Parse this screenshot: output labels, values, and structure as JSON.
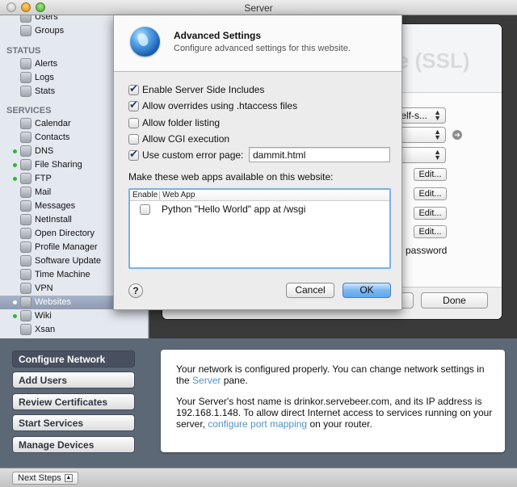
{
  "window": {
    "title": "Server"
  },
  "sidebar": {
    "sections": [
      {
        "label": "STATUS"
      },
      {
        "label": "SERVICES"
      }
    ],
    "top_items": [
      {
        "label": "Users",
        "icon": "users-icon"
      },
      {
        "label": "Groups",
        "icon": "groups-icon"
      }
    ],
    "status_items": [
      {
        "label": "Alerts",
        "icon": "megaphone-icon"
      },
      {
        "label": "Logs",
        "icon": "logs-icon"
      },
      {
        "label": "Stats",
        "icon": "stats-icon"
      }
    ],
    "service_items": [
      {
        "label": "Calendar",
        "icon": "calendar-icon",
        "running": false
      },
      {
        "label": "Contacts",
        "icon": "contacts-icon",
        "running": false
      },
      {
        "label": "DNS",
        "icon": "dns-icon",
        "running": true
      },
      {
        "label": "File Sharing",
        "icon": "file-sharing-icon",
        "running": true
      },
      {
        "label": "FTP",
        "icon": "ftp-icon",
        "running": true
      },
      {
        "label": "Mail",
        "icon": "mail-icon",
        "running": false
      },
      {
        "label": "Messages",
        "icon": "messages-icon",
        "running": false
      },
      {
        "label": "NetInstall",
        "icon": "netinstall-icon",
        "running": false
      },
      {
        "label": "Open Directory",
        "icon": "open-directory-icon",
        "running": false
      },
      {
        "label": "Profile Manager",
        "icon": "profile-manager-icon",
        "running": false
      },
      {
        "label": "Software Update",
        "icon": "software-update-icon",
        "running": false
      },
      {
        "label": "Time Machine",
        "icon": "time-machine-icon",
        "running": false
      },
      {
        "label": "VPN",
        "icon": "vpn-icon",
        "running": false
      },
      {
        "label": "Websites",
        "icon": "websites-icon",
        "running": true,
        "selected": true
      },
      {
        "label": "Wiki",
        "icon": "wiki-icon",
        "running": true
      },
      {
        "label": "Xsan",
        "icon": "xsan-icon",
        "running": false
      }
    ]
  },
  "background_panel": {
    "title": "Server Website (SSL)",
    "ssl_popup": "elf-s...",
    "edit_label": "Edit...",
    "password_text": "password",
    "done_label": "Done"
  },
  "dialog": {
    "title": "Advanced Settings",
    "subtitle": "Configure advanced settings for this website.",
    "options": [
      {
        "label": "Enable Server Side Includes",
        "checked": true
      },
      {
        "label": "Allow overrides using .htaccess files",
        "checked": true
      },
      {
        "label": "Allow folder listing",
        "checked": false
      },
      {
        "label": "Allow CGI execution",
        "checked": false
      },
      {
        "label": "Use custom error page:",
        "checked": true
      }
    ],
    "error_page_value": "dammit.html",
    "webapps_label": "Make these web apps available on this website:",
    "table": {
      "columns": [
        "Enable",
        "Web App"
      ],
      "rows": [
        {
          "enabled": false,
          "app": "Python \"Hello World\" app at /wsgi"
        }
      ]
    },
    "help_label": "?",
    "cancel_label": "Cancel",
    "ok_label": "OK"
  },
  "next_steps": {
    "buttons": [
      {
        "label": "Configure Network",
        "active": true
      },
      {
        "label": "Add Users",
        "active": false
      },
      {
        "label": "Review Certificates",
        "active": false
      },
      {
        "label": "Start Services",
        "active": false
      },
      {
        "label": "Manage Devices",
        "active": false
      }
    ],
    "info": {
      "p1_before": "Your network is configured properly. You can change network settings in the ",
      "p1_link": "Server",
      "p1_after": " pane.",
      "p2_before": "Your Server's host name is drinkor.servebeer.com, and its IP address is 192.168.1.148. To allow direct Internet access to services running on your server, ",
      "p2_link": "configure port mapping",
      "p2_after": " on your router."
    },
    "toggle_label": "Next Steps"
  },
  "colors": {
    "accent_link": "#4e93c9",
    "running_dot": "#2fb733",
    "ok_button": "#7ab7f1",
    "bottom_background": "#5d6877"
  }
}
